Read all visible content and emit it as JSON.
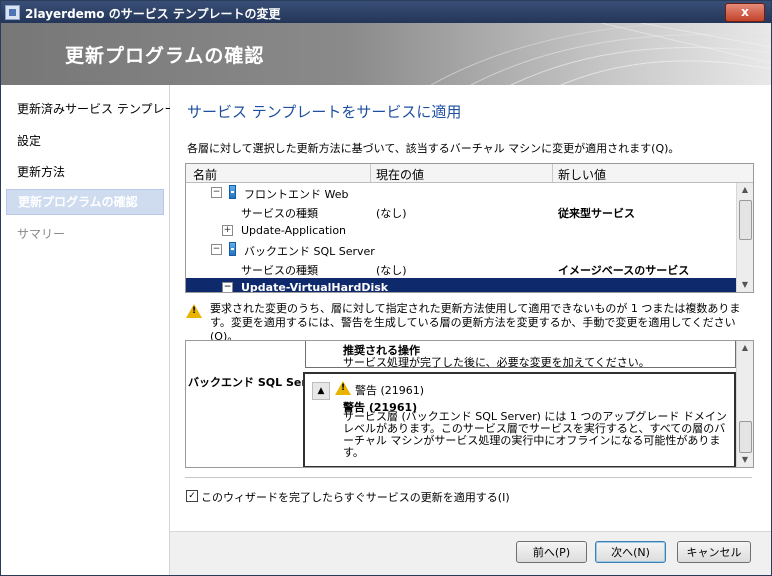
{
  "window": {
    "title": "2layerdemo のサービス テンプレートの変更",
    "close_glyph": "x"
  },
  "banner": {
    "heading": "更新プログラムの確認"
  },
  "sidebar": {
    "items": [
      {
        "label": "更新済みサービス テンプレート",
        "state": "normal"
      },
      {
        "label": "設定",
        "state": "normal"
      },
      {
        "label": "更新方法",
        "state": "normal"
      },
      {
        "label": "更新プログラムの確認",
        "state": "active"
      },
      {
        "label": "サマリー",
        "state": "disabled"
      }
    ]
  },
  "main": {
    "heading": "サービス テンプレートをサービスに適用",
    "description": "各層に対して選択した更新方法に基づいて、該当するバーチャル マシンに変更が適用されます(Q)。",
    "grid": {
      "columns": [
        "名前",
        "現在の値",
        "新しい値"
      ],
      "rows": [
        {
          "name": "フロントエンド Web",
          "current": "",
          "new": ""
        },
        {
          "name": "サービスの種類",
          "current": "(なし)",
          "new": "従来型サービス"
        },
        {
          "name": "Update-Application",
          "current": "",
          "new": ""
        },
        {
          "name": "バックエンド SQL Server",
          "current": "",
          "new": ""
        },
        {
          "name": "サービスの種類",
          "current": "(なし)",
          "new": "イメージベースのサービス"
        },
        {
          "name": "Update-VirtualHardDisk",
          "current": "",
          "new": ""
        }
      ]
    },
    "warning": "要求された変更のうち、層に対して指定された更新方法使用して適用できないものが 1 つまたは複数あります。変更を適用するには、警告を生成している層の更新方法を変更するか、手動で変更を適用してください(O)。",
    "detail": {
      "tier_label": "バックエンド SQL Server",
      "recommended_title": "推奨される操作",
      "recommended_text": "サービス処理が完了した後に、必要な変更を加えてください。",
      "warning_header": "警告 (21961)",
      "warning_title": "警告 (21961)",
      "warning_body": "サービス層 (バックエンド SQL Server) には 1 つのアップグレード ドメイン レベルがあります。このサービス層でサービスを実行すると、すべての層のバーチャル マシンがサービス処理の実行中にオフラインになる可能性があります。"
    },
    "apply_checkbox": {
      "label": "このウィザードを完了したらすぐサービスの更新を適用する(I)",
      "checked": true
    }
  },
  "footer": {
    "back_label": "前へ(P)",
    "next_label": "次へ(N)",
    "cancel_label": "キャンセル"
  },
  "colors": {
    "titlebar": "#243659",
    "heading_blue": "#1f4fa0",
    "selected_row": "#0f2a6c",
    "sidebar_active": "#cfdcf0",
    "warning_yellow": "#e8b400"
  },
  "icons": [
    "app-icon",
    "close-icon",
    "expand-icon",
    "collapse-icon",
    "tier-icon",
    "warning-icon",
    "scroll-up-icon",
    "scroll-down-icon",
    "chevron-up-icon",
    "checkmark-icon"
  ]
}
